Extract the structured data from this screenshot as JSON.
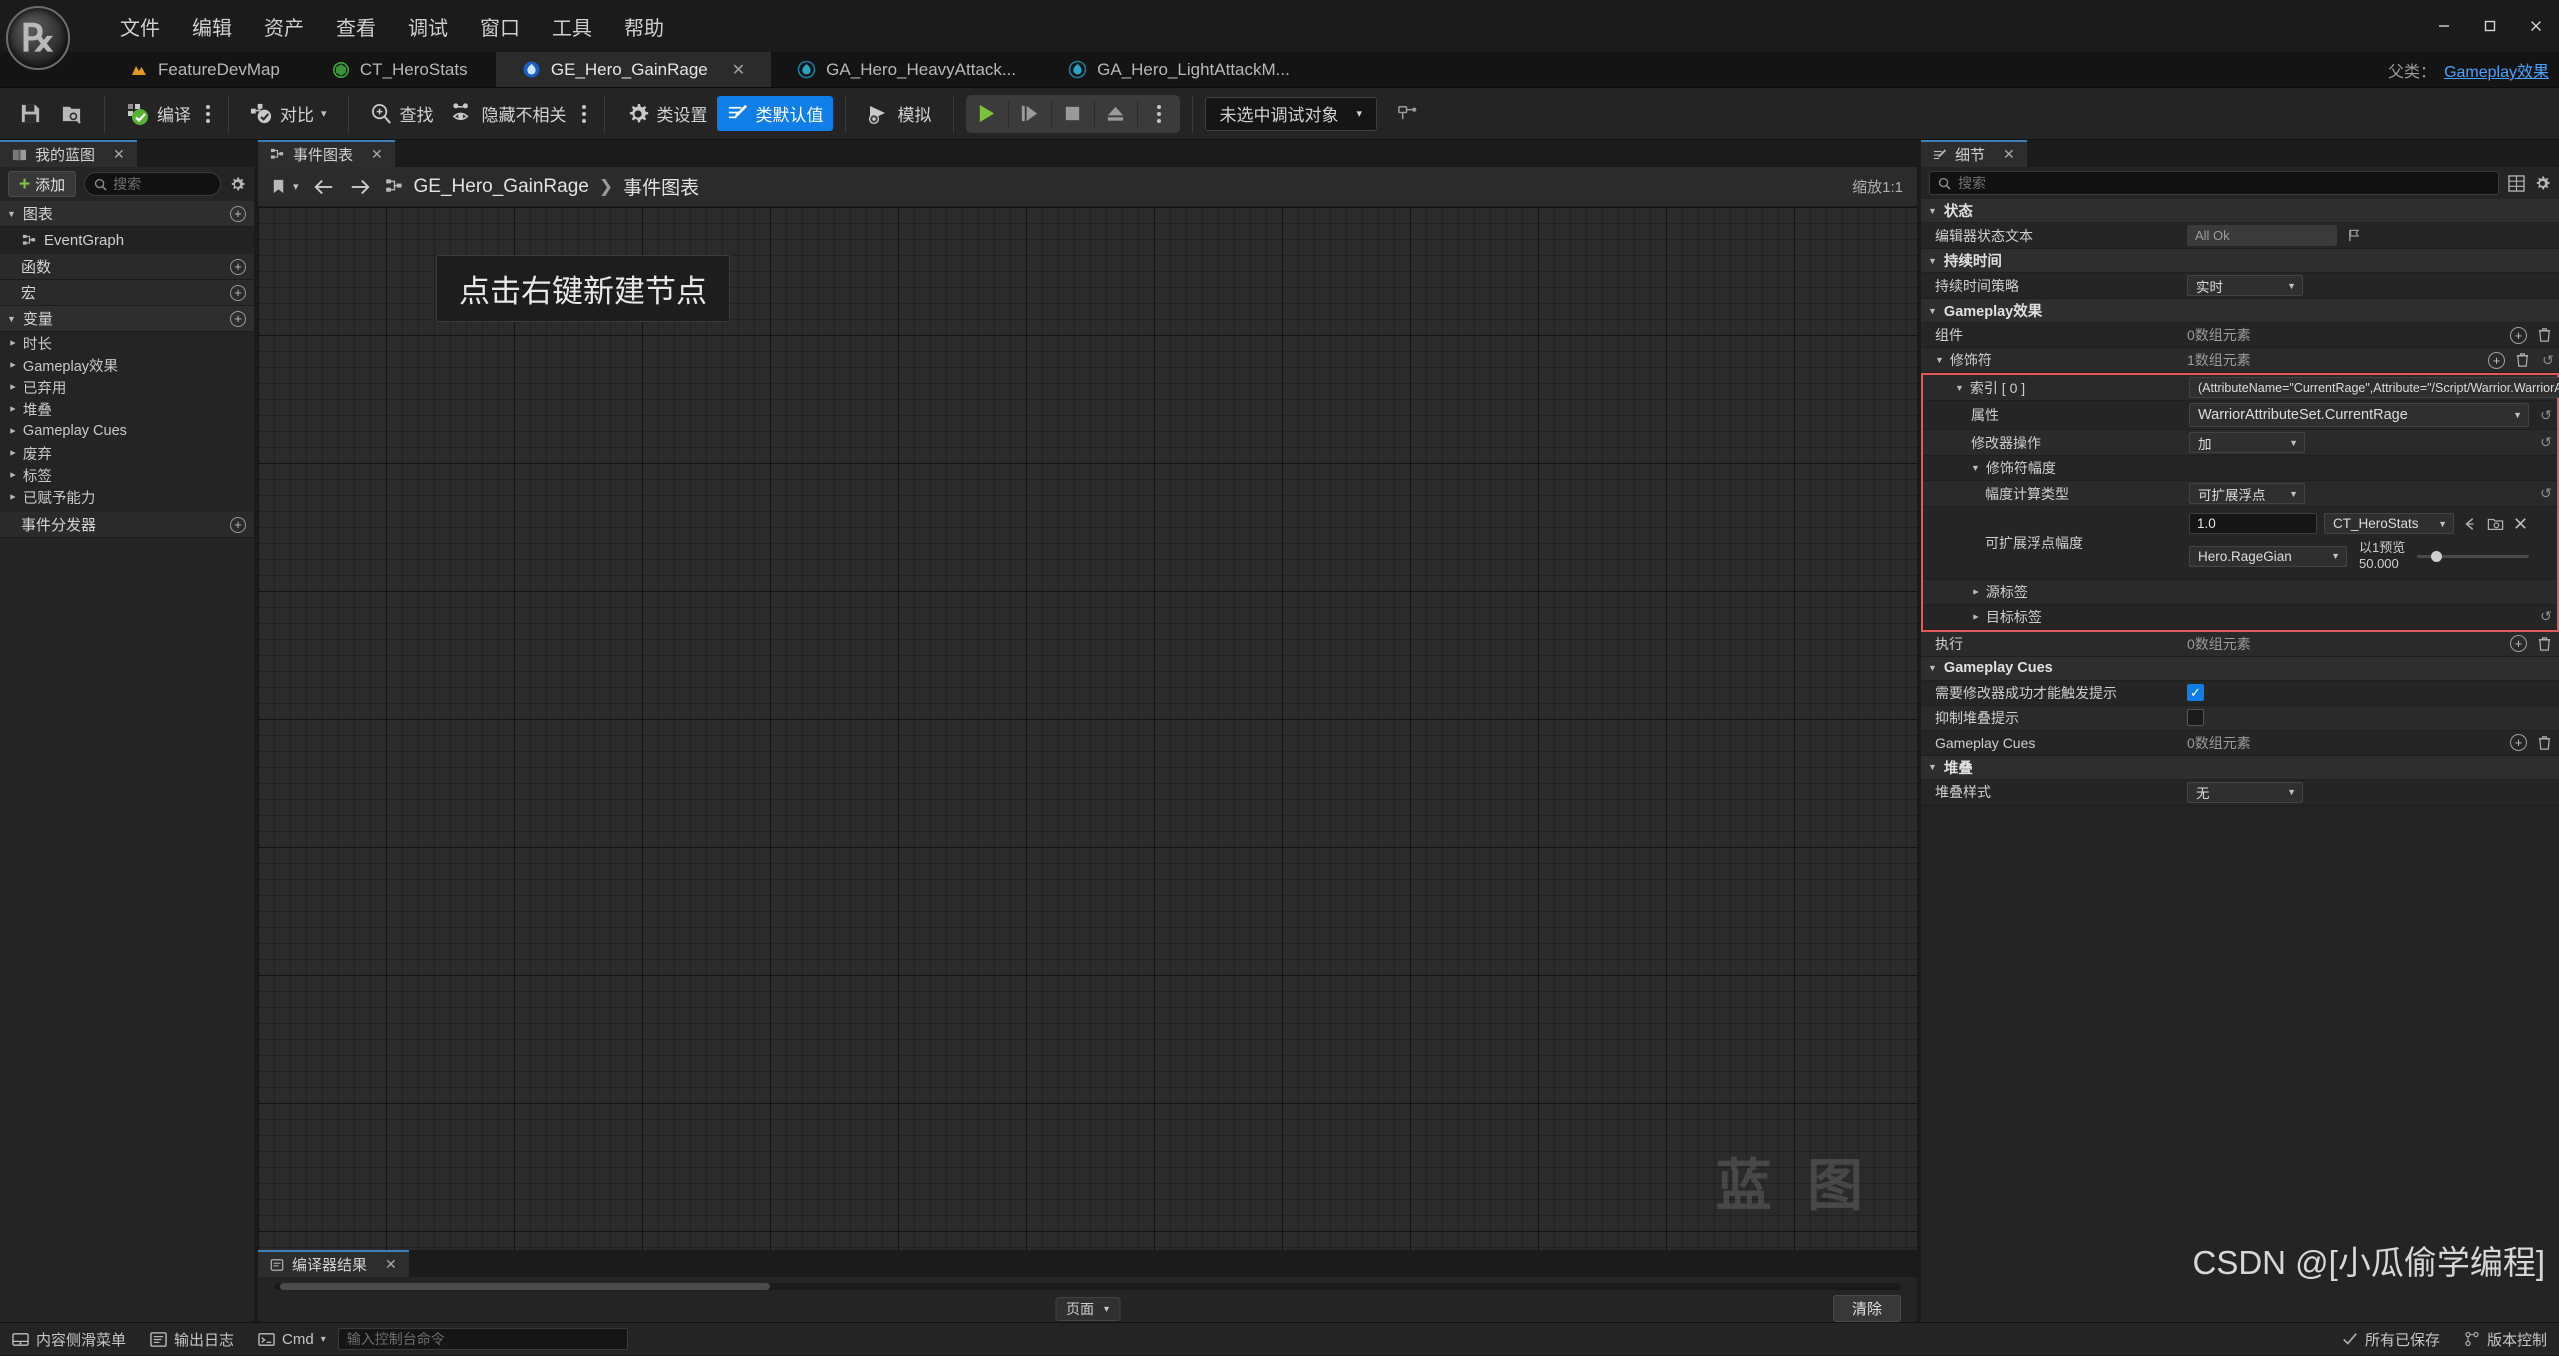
{
  "window": {
    "menu": [
      "文件",
      "编辑",
      "资产",
      "查看",
      "调试",
      "窗口",
      "工具",
      "帮助"
    ],
    "minimize": "—",
    "maximize": "▢",
    "close": "✕"
  },
  "asset_tabs": [
    {
      "label": "FeatureDevMap",
      "icon": "level-icon",
      "active": false,
      "closable": false
    },
    {
      "label": "CT_HeroStats",
      "icon": "curve-table-icon",
      "active": false,
      "closable": false
    },
    {
      "label": "GE_Hero_GainRage",
      "icon": "gameplay-effect-icon",
      "active": true,
      "closable": true,
      "close": "✕"
    },
    {
      "label": "GA_Hero_HeavyAttack...",
      "icon": "gameplay-ability-icon",
      "active": false,
      "closable": false
    },
    {
      "label": "GA_Hero_LightAttackM...",
      "icon": "gameplay-ability-icon",
      "active": false,
      "closable": false
    }
  ],
  "parent_info": {
    "label": "父类：",
    "link": "Gameplay效果"
  },
  "toolbar": {
    "save": "保存",
    "browse": "在内容浏览器中浏览",
    "compile": "编译",
    "diff": "对比",
    "find": "查找",
    "hide_unrelated": "隐藏不相关",
    "class_settings": "类设置",
    "class_defaults": "类默认值",
    "simulate": "模拟",
    "play": "▶",
    "step": "⏯",
    "stop": "■",
    "eject": "⏏",
    "debug_object": "未选中调试对象"
  },
  "my_blueprint": {
    "tab_title": "我的蓝图",
    "tab_close": "✕",
    "add_label": "添加",
    "search_placeholder": "搜索",
    "sections": [
      {
        "title": "图表",
        "expandable": true,
        "expanded": true,
        "items": [
          {
            "label": "EventGraph",
            "icon": "event-graph-icon"
          }
        ]
      },
      {
        "title": "函数",
        "expandable": false,
        "items": []
      },
      {
        "title": "宏",
        "expandable": false,
        "items": []
      }
    ],
    "variables_title": "变量",
    "variables": [
      "时长",
      "Gameplay效果",
      "已弃用",
      "堆叠",
      "Gameplay Cues",
      "废弃",
      "标签",
      "已赋予能力"
    ],
    "event_dispatchers_title": "事件分发器"
  },
  "event_graph": {
    "tab_title": "事件图表",
    "tab_close": "✕",
    "breadcrumb_root": "GE_Hero_GainRage",
    "breadcrumb_sep": "❯",
    "breadcrumb_leaf": "事件图表",
    "zoom_label": "缩放1:1",
    "hint": "点击右键新建节点",
    "watermark": "蓝 图"
  },
  "compiler_results": {
    "tab_title": "编译器结果",
    "tab_close": "✕",
    "page_label": "页面",
    "clear_label": "清除"
  },
  "details": {
    "tab_title": "细节",
    "tab_close": "✕",
    "search_placeholder": "搜索",
    "sections": [
      {
        "name": "状态",
        "rows": [
          {
            "label": "编辑器状态文本",
            "type": "text_flag",
            "value": "All Ok"
          }
        ]
      },
      {
        "name": "持续时间",
        "rows": [
          {
            "label": "持续时间策略",
            "type": "combo",
            "value": "实时"
          }
        ]
      },
      {
        "name": "Gameplay效果",
        "rows": [
          {
            "label": "组件",
            "type": "array",
            "value": "0数组元素"
          },
          {
            "label": "修饰符",
            "type": "array",
            "value": "1数组元素"
          }
        ]
      }
    ],
    "modifier": {
      "index_label": "索引 [ 0 ]",
      "index_value": "(AttributeName=\"CurrentRage\",Attribute=\"/Script/Warrior.WarriorAttributeS",
      "attribute_label": "属性",
      "attribute_value": "WarriorAttributeSet.CurrentRage",
      "op_label": "修改器操作",
      "op_value": "加",
      "magnitude_label": "修饰符幅度",
      "calc_type_label": "幅度计算类型",
      "calc_type_value": "可扩展浮点",
      "scalable_label": "可扩展浮点幅度",
      "scalable_number": "1.0",
      "curve_table": "CT_HeroStats",
      "row_name": "Hero.RageGian",
      "preview_label": "以1预览",
      "preview_value": "50.000",
      "source_tags_label": "源标签",
      "target_tags_label": "目标标签"
    },
    "exec_row": {
      "label": "执行",
      "value": "0数组元素"
    },
    "gameplay_cues": {
      "section": "Gameplay Cues",
      "rows": [
        {
          "label": "需要修改器成功才能触发提示",
          "type": "check",
          "checked": true
        },
        {
          "label": "抑制堆叠提示",
          "type": "check",
          "checked": false
        },
        {
          "label": "Gameplay Cues",
          "type": "array",
          "value": "0数组元素"
        }
      ]
    },
    "stacking": {
      "section": "堆叠",
      "rows": [
        {
          "label": "堆叠样式",
          "type": "combo",
          "value": "无"
        }
      ]
    }
  },
  "status_bar": {
    "content_menu": "内容侧滑菜单",
    "output_log": "输出日志",
    "cmd_label": "Cmd",
    "cmd_placeholder": "输入控制台命令",
    "saved": "所有已保存",
    "revision": "版本控制"
  },
  "watermark_overlay": "CSDN @[小瓜偷学编程]",
  "colors": {
    "accent_blue": "#0f7ee8",
    "highlight_red": "#e35a5a",
    "green": "#7ec64a",
    "tab_top": "#3d7fb8"
  }
}
